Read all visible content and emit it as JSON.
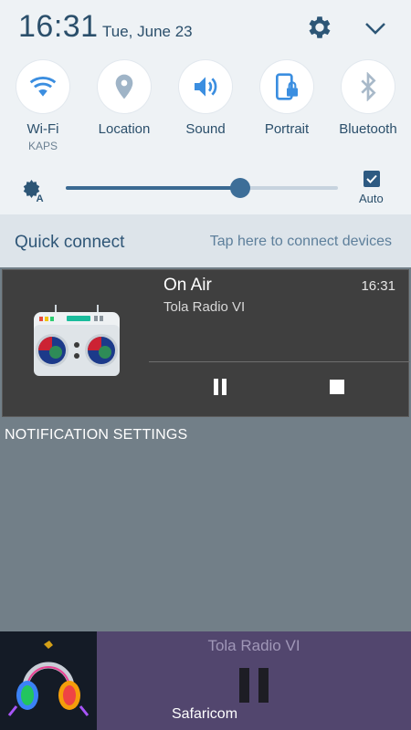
{
  "header": {
    "time": "16:31",
    "date": "Tue, June 23"
  },
  "toggles": [
    {
      "label": "Wi-Fi",
      "sublabel": "KAPS",
      "icon": "wifi-icon",
      "active": true
    },
    {
      "label": "Location",
      "sublabel": "",
      "icon": "location-icon",
      "active": false
    },
    {
      "label": "Sound",
      "sublabel": "",
      "icon": "sound-icon",
      "active": true
    },
    {
      "label": "Portrait",
      "sublabel": "",
      "icon": "portrait-lock-icon",
      "active": true
    },
    {
      "label": "Bluetooth",
      "sublabel": "",
      "icon": "bluetooth-icon",
      "active": false
    }
  ],
  "brightness": {
    "level": 0.64,
    "auto_label": "Auto",
    "auto_checked": true
  },
  "quick_connect": {
    "title": "Quick connect",
    "hint": "Tap here to connect devices"
  },
  "media_notification": {
    "title": "On Air",
    "subtitle": "Tola Radio VI",
    "time": "16:31"
  },
  "notification_settings_label": "NOTIFICATION SETTINGS",
  "app_bar": {
    "title": "Tola Radio VI",
    "carrier": "Safaricom"
  },
  "colors": {
    "accent": "#3a6a92",
    "panel_bg": "#eef2f5",
    "shade_bg": "#727f88",
    "notification_bg": "#3f3f3f",
    "app_bar_bg": "#52466e"
  }
}
